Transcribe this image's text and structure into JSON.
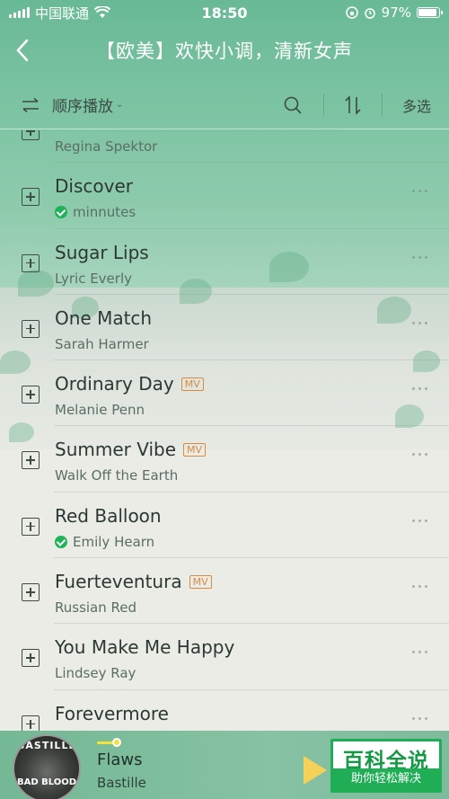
{
  "status_bar": {
    "carrier": "中国联通",
    "time": "18:50",
    "battery": "97%"
  },
  "header": {
    "title": "【欧美】欢快小调，清新女声"
  },
  "toolbar": {
    "play_mode": "顺序播放",
    "multi_select": "多选"
  },
  "songs": [
    {
      "title": "",
      "artist": "Regina Spektor",
      "mv": false,
      "downloaded": false
    },
    {
      "title": "Discover",
      "artist": "minnutes",
      "mv": false,
      "downloaded": true
    },
    {
      "title": "Sugar Lips",
      "artist": "Lyric Everly",
      "mv": false,
      "downloaded": false
    },
    {
      "title": "One Match",
      "artist": "Sarah Harmer",
      "mv": false,
      "downloaded": false
    },
    {
      "title": "Ordinary Day",
      "artist": "Melanie Penn",
      "mv": true,
      "downloaded": false
    },
    {
      "title": "Summer Vibe",
      "artist": "Walk Off the Earth",
      "mv": true,
      "downloaded": false
    },
    {
      "title": "Red Balloon",
      "artist": "Emily Hearn",
      "mv": false,
      "downloaded": true
    },
    {
      "title": "Fuerteventura",
      "artist": "Russian Red",
      "mv": true,
      "downloaded": false
    },
    {
      "title": "You Make Me Happy",
      "artist": "Lindsey Ray",
      "mv": false,
      "downloaded": false
    },
    {
      "title": "Forevermore",
      "artist": "",
      "mv": false,
      "downloaded": false
    }
  ],
  "mv_badge": "MV",
  "now_playing": {
    "title": "Flaws",
    "artist": "Bastille",
    "album_art_text": "BASTILLE",
    "album_art_subtext": "BAD BLOOD"
  },
  "watermark": {
    "main": "百科全说",
    "sub": "助你轻松解决"
  },
  "colors": {
    "header_green": "#69b996",
    "check_green": "#1fb256",
    "mv_orange": "#d98a42",
    "progress_yellow": "#f2e33b"
  }
}
